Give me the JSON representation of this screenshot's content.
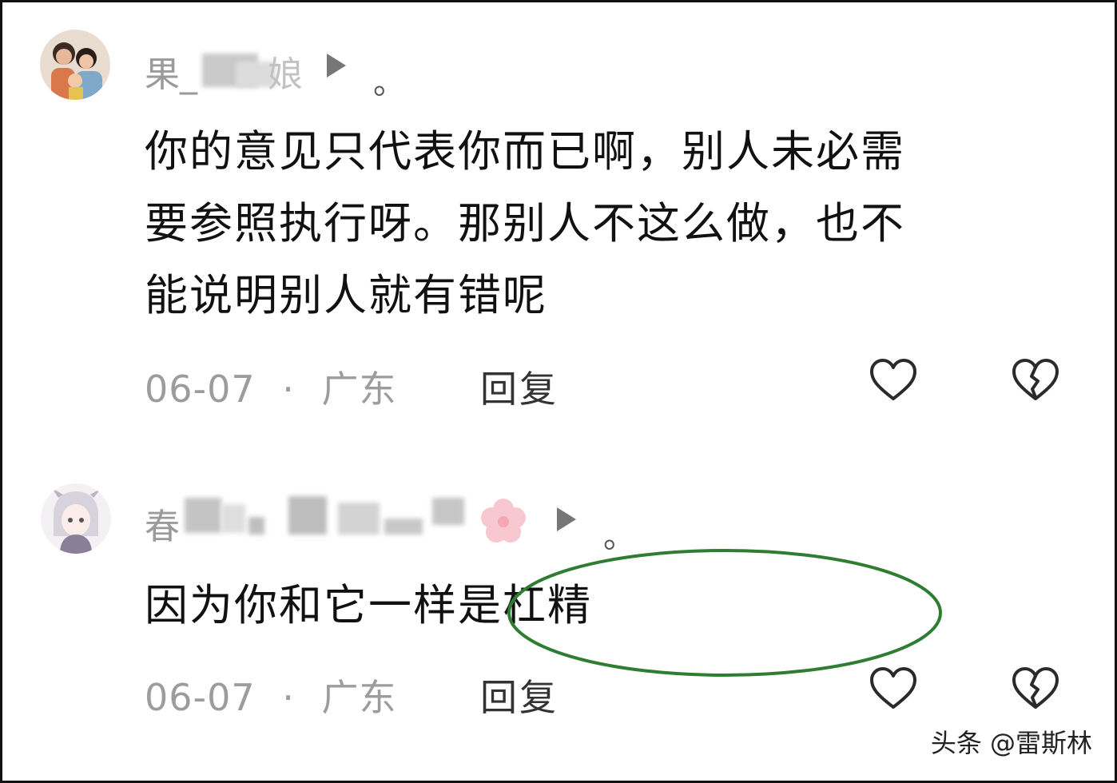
{
  "comments": [
    {
      "username_visible": "果_",
      "username_tail": "娘",
      "suffix": "。",
      "text_lines": [
        "你的意见只代表你而已啊，别人未必需",
        "要参照执行呀。那别人不这么做，也不",
        "能说明别人就有错呢"
      ],
      "date": "06-07",
      "separator": "·",
      "location": "广东",
      "reply_label": "回复"
    },
    {
      "username_visible": "春",
      "suffix": "。",
      "text_lines": [
        "因为你和它一样是杠精"
      ],
      "date": "06-07",
      "separator": "·",
      "location": "广东",
      "reply_label": "回复"
    }
  ],
  "watermark": "头条 @雷斯林",
  "colors": {
    "text": "#111111",
    "meta": "#9c9c9c",
    "annotation_ellipse": "#2e7d32"
  },
  "icons": {
    "like": "heart-outline-icon",
    "dislike": "broken-heart-icon",
    "more": "play-arrow-icon"
  }
}
